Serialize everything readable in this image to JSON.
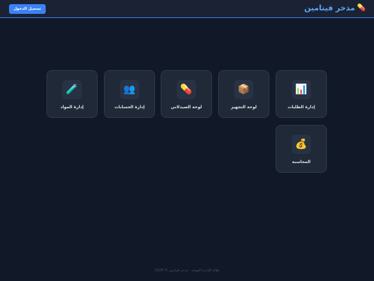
{
  "header": {
    "brand_name": "مذخر فيتامين",
    "brand_icon": "pill-icon",
    "login_label": "تسجيل الدخول"
  },
  "cards": [
    {
      "label": "إدارة الطلبات",
      "icon": "📊",
      "icon_name": "bar-chart-icon"
    },
    {
      "label": "لوحة التجهيز",
      "icon": "📦",
      "icon_name": "package-icon"
    },
    {
      "label": "لوحة الصيدلاني",
      "icon": "💊",
      "icon_name": "pill-icon"
    },
    {
      "label": "إدارة الحسابات",
      "icon": "👥",
      "icon_name": "users-icon"
    },
    {
      "label": "إدارة المواد",
      "icon": "🧪",
      "icon_name": "test-tube-icon"
    },
    {
      "label": "المحاسبة",
      "icon": "💰",
      "icon_name": "money-bag-icon"
    }
  ],
  "footer": {
    "text": "نظام الإدارة الموحد - مذخر فيتامين © 2026"
  },
  "colors": {
    "background": "#111827",
    "header": "#1a2233",
    "accent": "#3b82f6",
    "brand_text": "#60a5fa",
    "card": "#1f2937"
  }
}
